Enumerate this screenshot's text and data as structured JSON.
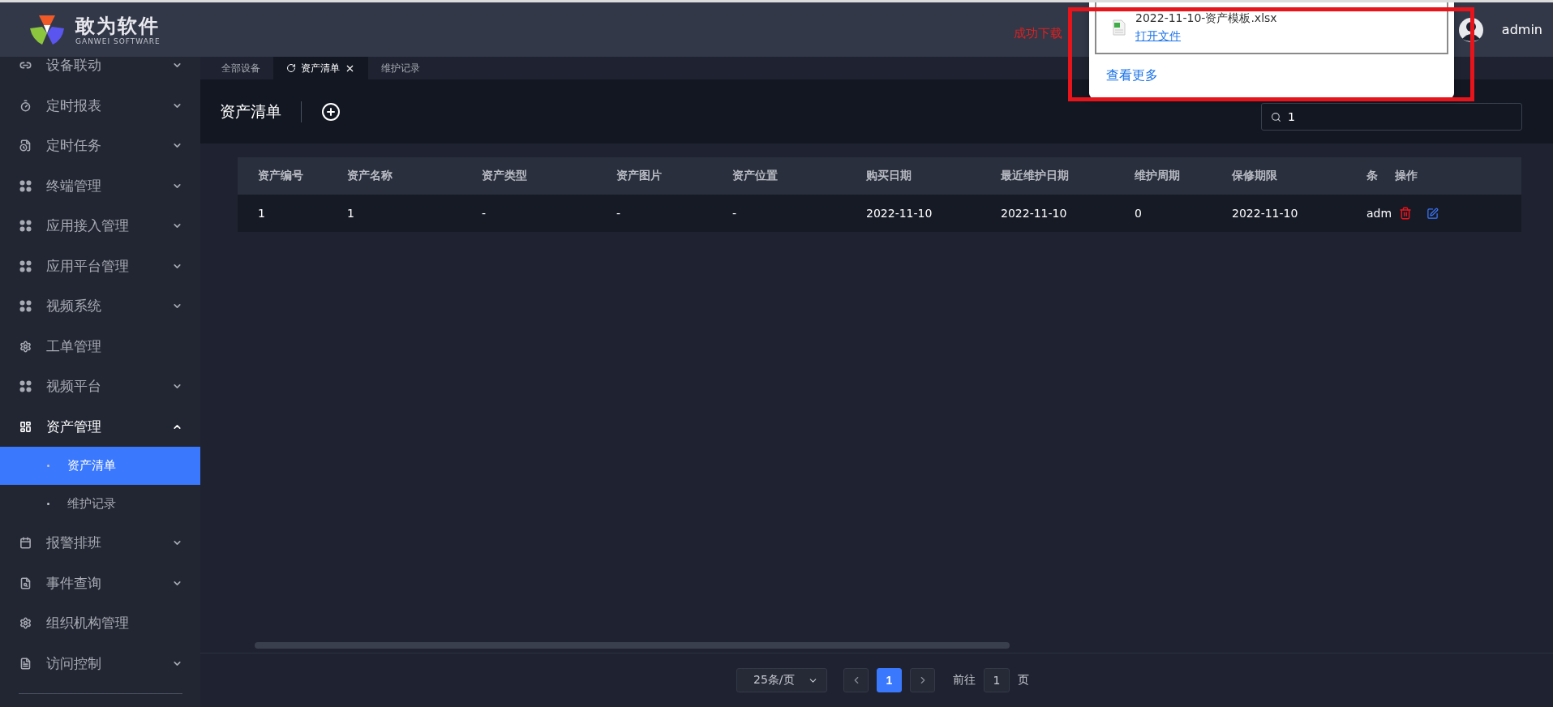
{
  "header": {
    "logo_text": "敢为软件",
    "logo_subtext": "GANWEI SOFTWARE",
    "notice": "成功下载",
    "username": "admin"
  },
  "download_popup": {
    "file_name": "2022-11-10-资产模板.xlsx",
    "open_link": "打开文件",
    "more_link": "查看更多"
  },
  "sidebar": {
    "items": [
      {
        "label": "设备联动",
        "kind": "group",
        "expanded": false
      },
      {
        "label": "定时报表",
        "kind": "group",
        "expanded": false
      },
      {
        "label": "定时任务",
        "kind": "group",
        "expanded": false
      },
      {
        "label": "终端管理",
        "kind": "group",
        "expanded": false
      },
      {
        "label": "应用接入管理",
        "kind": "group",
        "expanded": false
      },
      {
        "label": "应用平台管理",
        "kind": "group",
        "expanded": false
      },
      {
        "label": "视频系统",
        "kind": "group",
        "expanded": false
      },
      {
        "label": "工单管理",
        "kind": "leaf"
      },
      {
        "label": "视频平台",
        "kind": "group",
        "expanded": false
      },
      {
        "label": "资产管理",
        "kind": "group",
        "expanded": true,
        "children": [
          {
            "label": "资产清单",
            "selected": true
          },
          {
            "label": "维护记录",
            "selected": false
          }
        ]
      },
      {
        "label": "报警排班",
        "kind": "group",
        "expanded": false
      },
      {
        "label": "事件查询",
        "kind": "group",
        "expanded": false
      },
      {
        "label": "组织机构管理",
        "kind": "leaf"
      },
      {
        "label": "访问控制",
        "kind": "group",
        "expanded": false
      }
    ]
  },
  "tabs": [
    {
      "label": "全部设备",
      "selected": false
    },
    {
      "label": "资产清单",
      "selected": true
    },
    {
      "label": "维护记录",
      "selected": false
    }
  ],
  "page_title": "资产清单",
  "search": {
    "value": "1"
  },
  "table": {
    "columns": [
      "资产编号",
      "资产名称",
      "资产类型",
      "资产图片",
      "资产位置",
      "购买日期",
      "最近维护日期",
      "维护周期",
      "保修期限",
      "条"
    ],
    "fixed_column": "操作",
    "rows": [
      [
        "1",
        "1",
        "-",
        "-",
        "-",
        "2022-11-10",
        "2022-11-10",
        "0",
        "2022-11-10",
        "adm"
      ]
    ]
  },
  "pagination": {
    "page_size": "25条/页",
    "pages": [
      {
        "label": "1",
        "selected": true
      }
    ],
    "goto_label": "前往",
    "goto_value": "1",
    "page_suffix": "页"
  }
}
